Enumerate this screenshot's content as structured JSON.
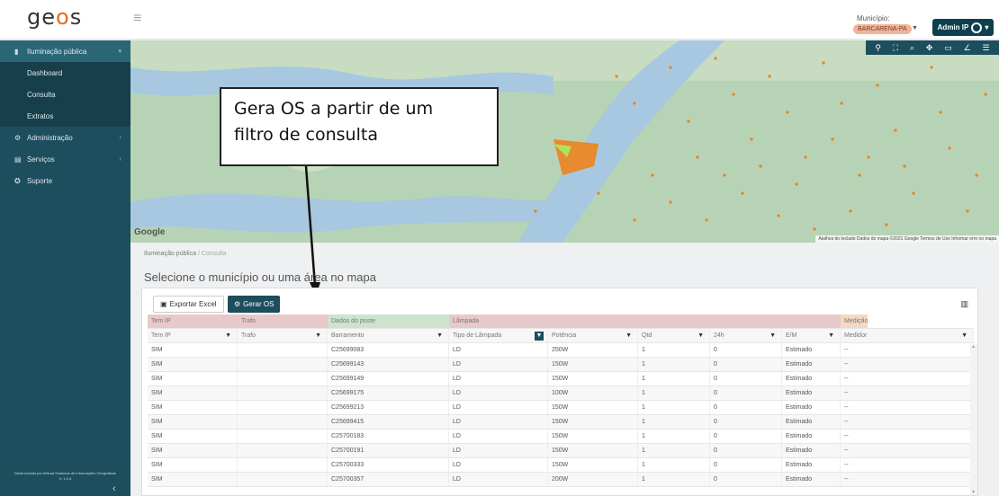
{
  "header": {
    "logo_text_a": "ge",
    "logo_text_pin": "o",
    "logo_text_b": "s",
    "municipio_label": "Município:",
    "municipio_value": "BARCARENA-PA",
    "admin_label": "Admin IP"
  },
  "sidebar": {
    "items": [
      {
        "label": "Iluminação pública",
        "icon": "lamp-icon",
        "kind": "section"
      },
      {
        "label": "Dashboard",
        "kind": "sub"
      },
      {
        "label": "Consulta",
        "kind": "sub-active"
      },
      {
        "label": "Extratos",
        "kind": "sub"
      },
      {
        "label": "Administração",
        "icon": "gear-icon",
        "kind": "section"
      },
      {
        "label": "Serviços",
        "icon": "services-icon",
        "kind": "section"
      },
      {
        "label": "Suporte",
        "icon": "support-icon",
        "kind": "section"
      }
    ],
    "footer": "Desenvolvido por eMcad Sistemas de Informações Geográficas",
    "version": "V. 1.0.4"
  },
  "map": {
    "google": "Google",
    "attribution": "Atalhos do teclado   Dados do mapa ©2021 Google   Termos de Uso   Informar erro no mapa",
    "toolbar_icons": [
      "pin-icon",
      "fullscreen-icon",
      "search-icon",
      "move-icon",
      "layer-icon",
      "draw-icon",
      "list-icon"
    ]
  },
  "callout": {
    "line1": "Gera OS a partir de um",
    "line2": "filtro de consulta"
  },
  "content": {
    "breadcrumb_root": "Iluminação pública",
    "breadcrumb_sep": "/",
    "breadcrumb_current": "Consulta",
    "title": "Selecione o município ou uma área no mapa",
    "btn_excel": "Exportar Excel",
    "btn_os": "Gerar OS"
  },
  "table": {
    "groups": [
      {
        "label": "Tem IP",
        "span": 1,
        "color": "#e8c9c9"
      },
      {
        "label": "Trafo",
        "span": 1,
        "color": "#e8c9c9"
      },
      {
        "label": "Dados do poste",
        "span": 1,
        "color": "#cde3cd"
      },
      {
        "label": "Lâmpada",
        "span": 5,
        "color": "#e8c9c9"
      },
      {
        "label": "Medição",
        "span": 2,
        "color": "#f3d9c4"
      }
    ],
    "columns": [
      "Tem IP",
      "Trafo",
      "Barramento",
      "Tipo de Lâmpada",
      "Potência",
      "Qtd",
      "24h",
      "E/M",
      "Medidor"
    ],
    "rows": [
      [
        "SIM",
        "",
        "C25699083",
        "LD",
        "250W",
        "1",
        "0",
        "Estimado",
        "--"
      ],
      [
        "SIM",
        "",
        "C25699143",
        "LD",
        "150W",
        "1",
        "0",
        "Estimado",
        "--"
      ],
      [
        "SIM",
        "",
        "C25699149",
        "LD",
        "150W",
        "1",
        "0",
        "Estimado",
        "--"
      ],
      [
        "SIM",
        "",
        "C25699175",
        "LD",
        "100W",
        "1",
        "0",
        "Estimado",
        "--"
      ],
      [
        "SIM",
        "",
        "C25699213",
        "LD",
        "150W",
        "1",
        "0",
        "Estimado",
        "--"
      ],
      [
        "SIM",
        "",
        "C25699415",
        "LD",
        "150W",
        "1",
        "0",
        "Estimado",
        "--"
      ],
      [
        "SIM",
        "",
        "C25700183",
        "LD",
        "150W",
        "1",
        "0",
        "Estimado",
        "--"
      ],
      [
        "SIM",
        "",
        "C25700191",
        "LD",
        "150W",
        "1",
        "0",
        "Estimado",
        "--"
      ],
      [
        "SIM",
        "",
        "C25700333",
        "LD",
        "150W",
        "1",
        "0",
        "Estimado",
        "--"
      ],
      [
        "SIM",
        "",
        "C25700357",
        "LD",
        "200W",
        "1",
        "0",
        "Estimado",
        "--"
      ]
    ]
  }
}
